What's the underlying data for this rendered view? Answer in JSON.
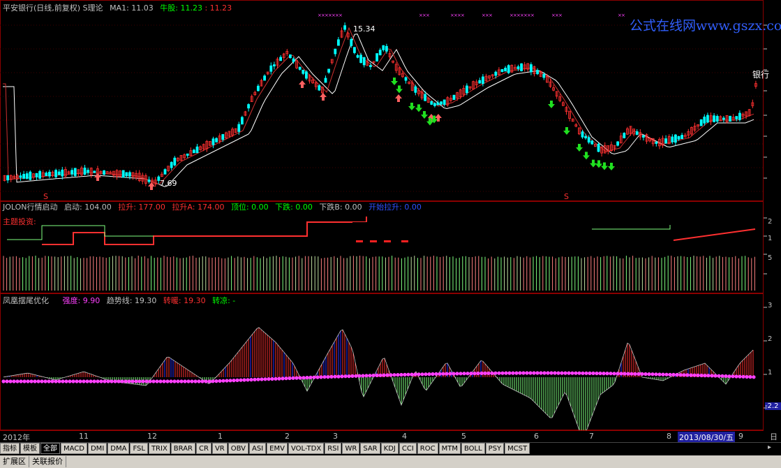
{
  "main_panel": {
    "title": "平安银行(日线,前复权) S理论",
    "ma_label": "MA1: 11.03",
    "niugu_label": "牛股: 11.23",
    "niugu_value2": ": 11.23",
    "high_label": "15.34",
    "low_label": "7.69",
    "stock_tag": "银行",
    "buy_label": "买",
    "s_marker": "S",
    "watermark": "公式在线网www.gszx.com.cn"
  },
  "panel2": {
    "title": "JOLON行情启动",
    "items": [
      {
        "text": "启动: 104.00",
        "color": "#c0c0c0"
      },
      {
        "text": "拉升: 177.00",
        "color": "#ff3030"
      },
      {
        "text": "拉升A: 174.00",
        "color": "#ff3030"
      },
      {
        "text": "顶位: 0.00",
        "color": "#00ff00"
      },
      {
        "text": "下跌: 0.00",
        "color": "#00ff00"
      },
      {
        "text": "下跌B: 0.00",
        "color": "#c0c0c0"
      },
      {
        "text": "开始拉升: 0.00",
        "color": "#3050ff"
      }
    ],
    "sub_label": "主题投资:",
    "axis": [
      "2",
      "1",
      "5"
    ]
  },
  "panel3": {
    "title": "凤凰摆尾优化",
    "items": [
      {
        "text": "强度: 9.90",
        "color": "#ff40ff"
      },
      {
        "text": "趋势线: 19.30",
        "color": "#c0c0c0"
      },
      {
        "text": "转暖: 19.30",
        "color": "#ff3030"
      },
      {
        "text": "转凉: -",
        "color": "#00ff00"
      }
    ],
    "axis": [
      "3",
      "2",
      "1",
      "-2.2"
    ]
  },
  "date_axis": {
    "labels": [
      "2012年",
      "11",
      "12",
      "1",
      "2",
      "3",
      "4",
      "5",
      "6",
      "7",
      "8",
      "9"
    ],
    "current_date": "2013/08/30/五",
    "right_label": "日"
  },
  "tabs": [
    "指标",
    "模板",
    "全部",
    "MACD",
    "DMI",
    "DMA",
    "FSL",
    "TRIX",
    "BRAR",
    "CR",
    "VR",
    "OBV",
    "ASI",
    "EMV",
    "VOL-TDX",
    "RSI",
    "WR",
    "SAR",
    "KDJ",
    "CCI",
    "ROC",
    "MTM",
    "BOLL",
    "PSY",
    "MCST"
  ],
  "active_tab": "全部",
  "bottom_tabs": [
    "扩展区",
    "关联报价"
  ],
  "colors": {
    "up": "#ff3030",
    "down": "#00ffff",
    "green": "#00ff00",
    "magenta": "#ff40ff",
    "border": "#8b0000"
  }
}
